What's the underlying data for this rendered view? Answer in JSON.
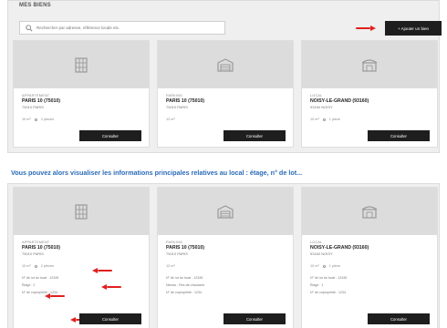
{
  "page": {
    "title": "MES BIENS"
  },
  "search": {
    "placeholder": "Rechercher par adresse, référence locale etc."
  },
  "toolbar": {
    "add_label": "+ Ajouter un bien"
  },
  "caption": "Vous pouvez alors visualiser les informations principales relatives au local : étage, n° de lot...",
  "cards": [
    {
      "type": "Appartement",
      "name": "PARIS 10 (75010)",
      "city": "75010 PARIS",
      "meta_left": "10 m²",
      "meta_right": "2 pièces",
      "button": "Consulter"
    },
    {
      "type": "Parking",
      "name": "PARIS 10 (75010)",
      "city": "75010 PARIS",
      "meta_left": "12 m²",
      "meta_right": "",
      "button": "Consulter"
    },
    {
      "type": "Local",
      "name": "NOISY-LE-GRAND (93160)",
      "city": "93160 NOISY",
      "meta_left": "10 m²",
      "meta_right": "1 pièce",
      "button": "Consulter"
    }
  ],
  "details": [
    {
      "lines": [
        "N° de lot du local : 12345",
        "Étage : 2",
        "N° de copropriété : 1234"
      ]
    },
    {
      "lines": [
        "N° de lot du local : 12345",
        "Niveau : Rez-de-chaussée",
        "N° de copropriété : 1234"
      ]
    },
    {
      "lines": [
        "N° de lot du local : 12345",
        "Étage : 1",
        "N° de copropriété : 1234"
      ]
    }
  ],
  "icons": {
    "search": "search-icon",
    "apartment": "building-icon",
    "parking": "garage-icon",
    "local": "shop-icon",
    "arrow": "red-arrow-icon"
  },
  "colors": {
    "accent_blue": "#2a6bb8",
    "arrow_red": "#e0201f",
    "button_dark": "#1e1e1e",
    "panel_bg": "#efefef",
    "photo_bg": "#dcdcdc"
  }
}
